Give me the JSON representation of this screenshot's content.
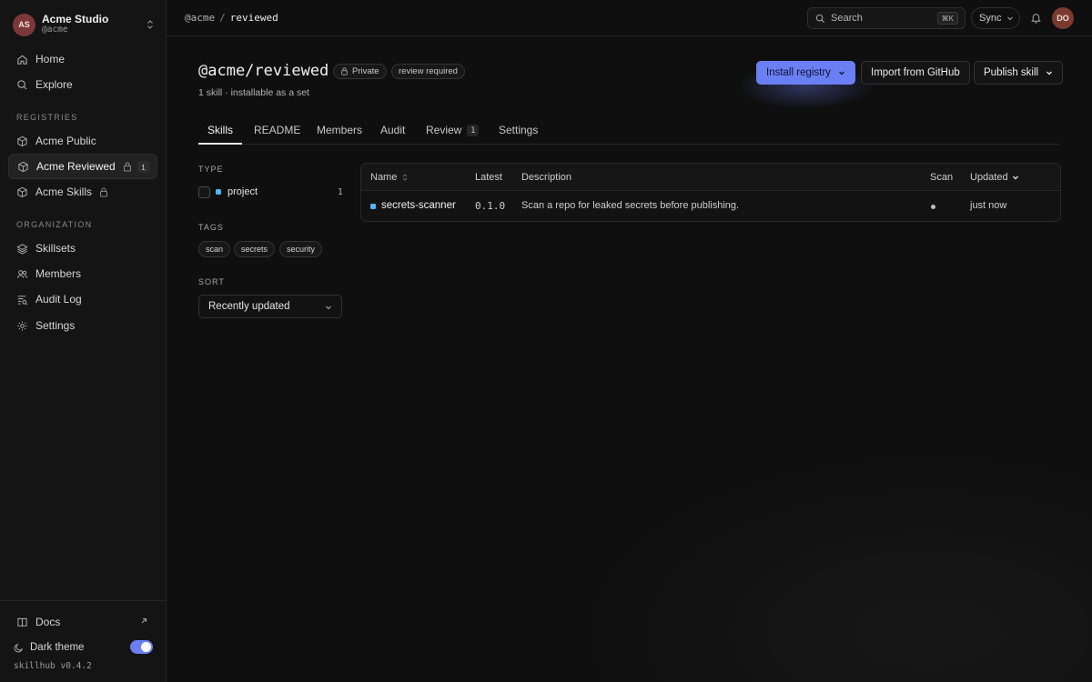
{
  "workspace": {
    "initials": "AS",
    "name": "Acme Studio",
    "handle": "@acme"
  },
  "sidebar": {
    "nav": [
      {
        "label": "Home",
        "icon": "home-icon"
      },
      {
        "label": "Explore",
        "icon": "search-icon"
      }
    ],
    "registries_heading": "REGISTRIES",
    "registries": [
      {
        "label": "Acme Public",
        "icon": "package-icon",
        "locked": false
      },
      {
        "label": "Acme Reviewed",
        "icon": "package-icon",
        "locked": true,
        "count": "1",
        "active": true
      },
      {
        "label": "Acme Skills",
        "icon": "package-icon",
        "locked": true
      }
    ],
    "organization_heading": "ORGANIZATION",
    "organization": [
      {
        "label": "Skillsets",
        "icon": "layers-icon"
      },
      {
        "label": "Members",
        "icon": "users-icon"
      },
      {
        "label": "Audit Log",
        "icon": "audit-log-icon"
      },
      {
        "label": "Settings",
        "icon": "gear-icon"
      }
    ],
    "docs_label": "Docs",
    "theme_label": "Dark theme",
    "theme_on": true,
    "version": "skillhub v0.4.2"
  },
  "topbar": {
    "breadcrumb": {
      "parent": "@acme",
      "separator": "/",
      "current": "reviewed"
    },
    "search_placeholder": "Search",
    "search_shortcut": "⌘K",
    "sync_label": "Sync",
    "user_initials": "DO"
  },
  "header": {
    "title": "@acme/reviewed",
    "badge_private": "Private",
    "badge_review": "review required",
    "subtitle": "1 skill · installable as a set",
    "install_label": "Install registry",
    "import_label": "Import from GitHub",
    "publish_label": "Publish skill"
  },
  "tabs": [
    {
      "label": "Skills",
      "active": true
    },
    {
      "label": "README"
    },
    {
      "label": "Members"
    },
    {
      "label": "Audit"
    },
    {
      "label": "Review",
      "count": "1"
    },
    {
      "label": "Settings"
    }
  ],
  "filters": {
    "type_heading": "TYPE",
    "type_option": {
      "label": "project",
      "count": "1",
      "checked": false
    },
    "tags_heading": "TAGS",
    "tags": [
      "scan",
      "secrets",
      "security"
    ],
    "sort_heading": "SORT",
    "sort_value": "Recently updated"
  },
  "table": {
    "columns": {
      "name": "Name",
      "latest": "Latest",
      "description": "Description",
      "scan": "Scan",
      "updated": "Updated"
    },
    "rows": [
      {
        "name": "secrets-scanner",
        "latest": "0.1.0",
        "description": "Scan a repo for leaked secrets before publishing.",
        "scan": "●",
        "updated": "just now"
      }
    ]
  },
  "colors": {
    "accent": "#6b7ff5",
    "project_dot": "#4fb6f0",
    "avatar": "#7a3838"
  }
}
